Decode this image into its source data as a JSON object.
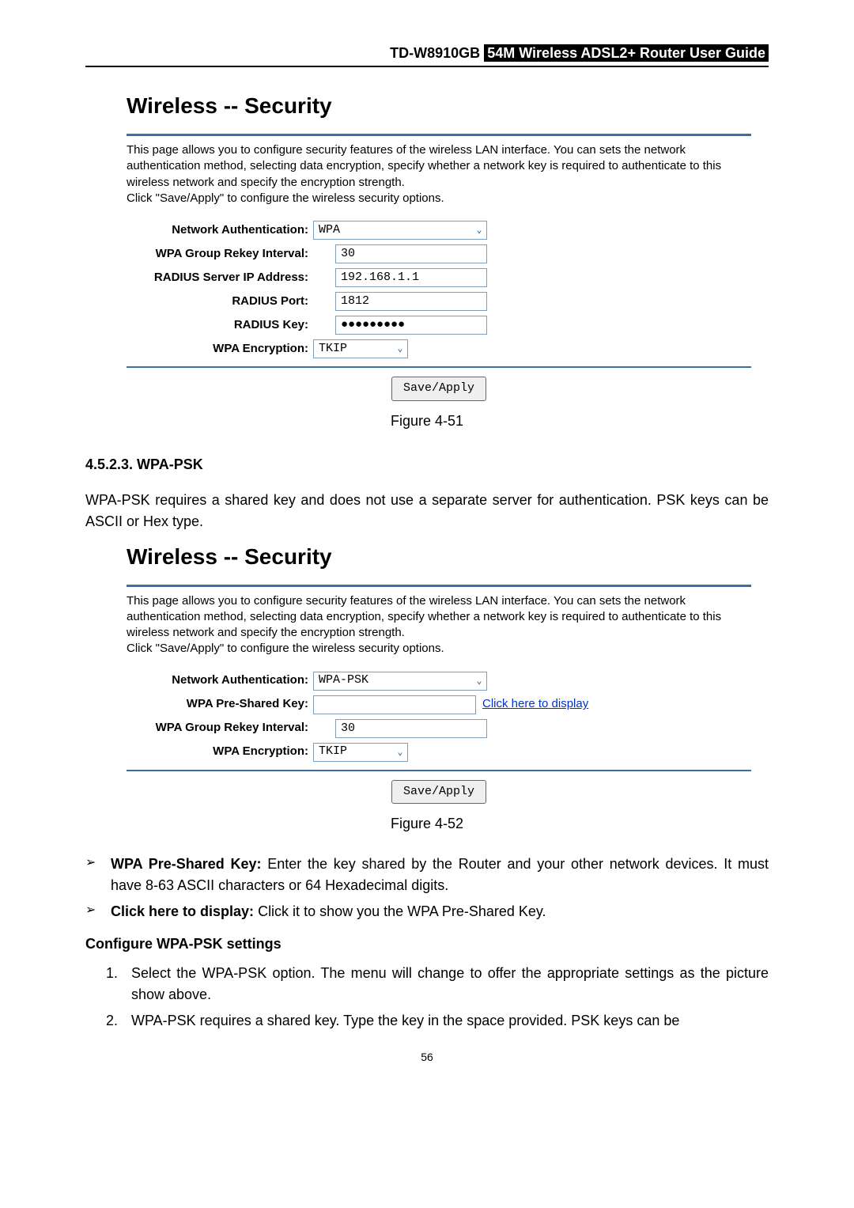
{
  "header": {
    "model": "TD-W8910GB",
    "title_inverse": "54M  Wireless  ADSL2+  Router  User  Guide"
  },
  "shot_common": {
    "title": "Wireless -- Security",
    "desc_line1": "This page allows you to configure security features of the wireless LAN interface. You can sets the network authentication method, selecting data encryption, specify whether a network key is required to authenticate to this wireless network and specify the encryption strength.",
    "desc_line2": "Click \"Save/Apply\" to configure the wireless security options.",
    "save_apply": "Save/Apply"
  },
  "shot51": {
    "labels": {
      "net_auth": "Network Authentication:",
      "group_rekey": "WPA Group Rekey Interval:",
      "radius_ip": "RADIUS Server IP Address:",
      "radius_port": "RADIUS Port:",
      "radius_key": "RADIUS Key:",
      "wpa_enc": "WPA Encryption:"
    },
    "values": {
      "net_auth": "WPA",
      "group_rekey": "30",
      "radius_ip": "192.168.1.1",
      "radius_port": "1812",
      "radius_key": "●●●●●●●●●",
      "wpa_enc": "TKIP"
    },
    "caption": "Figure 4-51"
  },
  "section": {
    "num_title": "4.5.2.3.   WPA-PSK",
    "para": "WPA-PSK requires a shared key and does not use a separate server for authentication. PSK keys can be ASCII or Hex type."
  },
  "shot52": {
    "labels": {
      "net_auth": "Network Authentication:",
      "psk": "WPA Pre-Shared Key:",
      "group_rekey": "WPA Group Rekey Interval:",
      "wpa_enc": "WPA Encryption:"
    },
    "values": {
      "net_auth": "WPA-PSK",
      "psk": "",
      "group_rekey": "30",
      "wpa_enc": "TKIP"
    },
    "link": "Click here to display",
    "caption": "Figure 4-52"
  },
  "bullets": {
    "b1_strong": "WPA Pre-Shared Key:",
    "b1_text": " Enter the key shared by the Router and your other network devices. It must have 8-63 ASCII characters or 64 Hexadecimal digits.",
    "b2_strong": "Click here to display:",
    "b2_text": " Click it to show you the WPA Pre-Shared Key."
  },
  "configure": {
    "heading": "Configure WPA-PSK settings",
    "step1": "Select the WPA-PSK option. The menu will change to offer the appropriate settings as the picture show above.",
    "step2": "WPA-PSK requires a shared key. Type the key in the space provided. PSK keys can be"
  },
  "page_number": "56"
}
